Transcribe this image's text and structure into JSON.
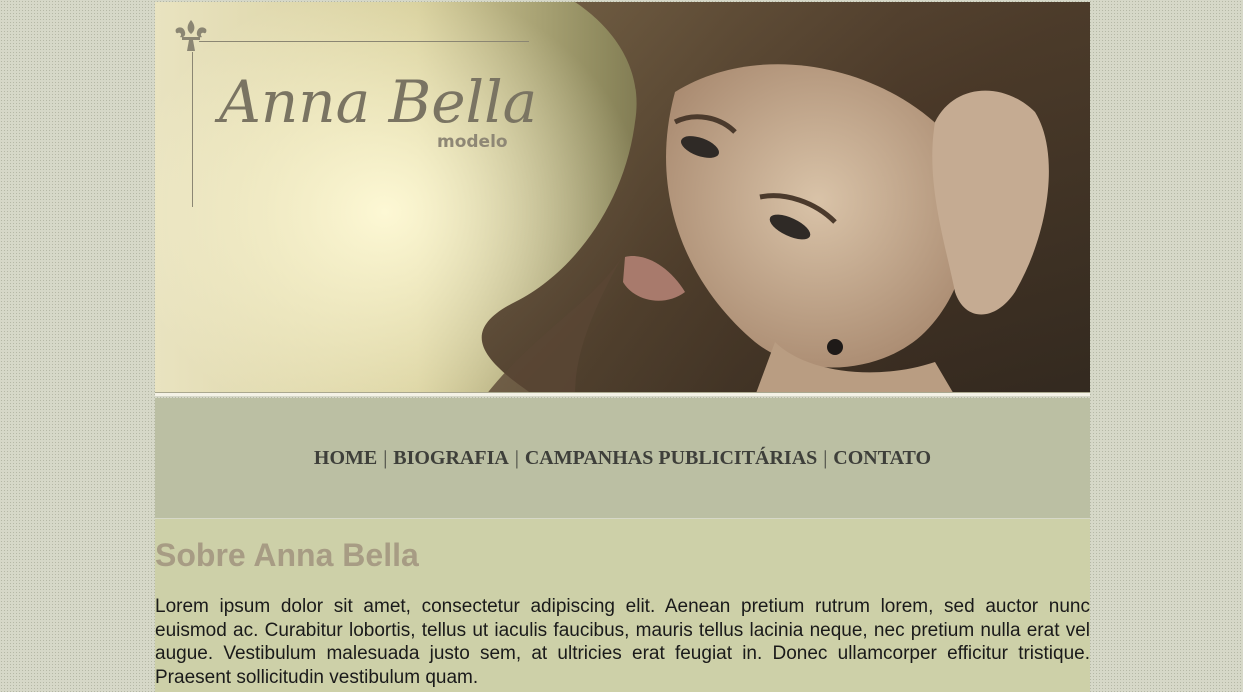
{
  "brand": {
    "name": "Anna Bella",
    "subtitle": "modelo"
  },
  "nav": {
    "items": [
      {
        "label": "HOME"
      },
      {
        "label": "BIOGRAFIA"
      },
      {
        "label": "CAMPANHAS PUBLICITÁRIAS"
      },
      {
        "label": "CONTATO"
      }
    ],
    "separator": "|"
  },
  "content": {
    "title": "Sobre Anna Bella",
    "paragraph": "Lorem ipsum dolor sit amet, consectetur adipiscing elit. Aenean pretium rutrum lorem, sed auctor nunc euismod ac. Curabitur lobortis, tellus ut iaculis faucibus, mauris tellus lacinia neque, nec pretium nulla erat vel augue. Vestibulum malesuada justo sem, at ultricies erat feugiat in. Donec ullamcorper efficitur tristique. Praesent sollicitudin vestibulum quam."
  },
  "colors": {
    "page_bg": "#d6d8c8",
    "nav_bg": "#bbbfa3",
    "content_bg": "#cdd0a8",
    "heading": "#a79c84",
    "nav_text": "#3e3f3a"
  },
  "icons": {
    "logo_ornament": "fleur-de-lis-icon"
  }
}
